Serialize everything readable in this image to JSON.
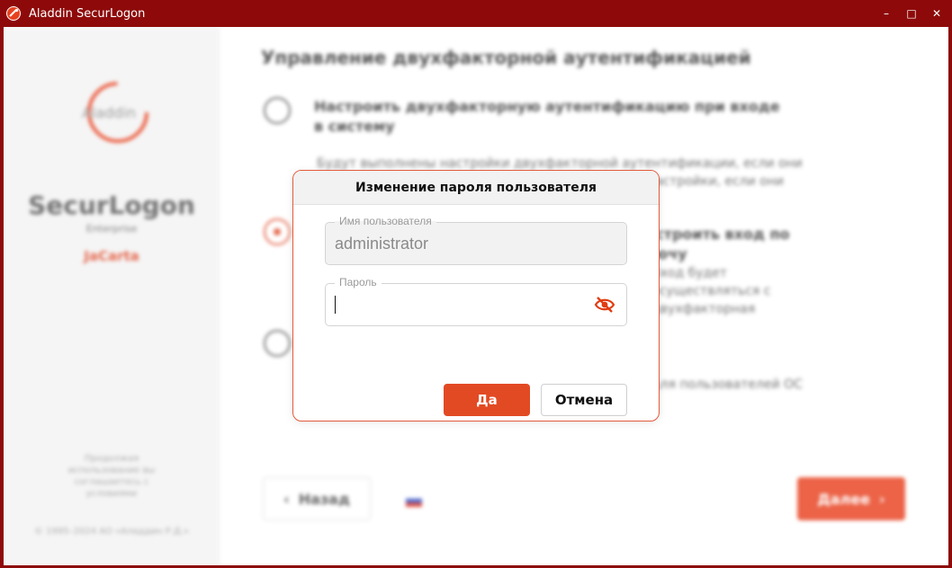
{
  "window": {
    "title": "Aladdin SecurLogon",
    "controls": {
      "minimize": "–",
      "maximize": "□",
      "close": "✕"
    }
  },
  "sidebar": {
    "logo_text": "Aladdin",
    "product_name": "SecurLogon",
    "edition": "Enterprise",
    "variant": "JaCarta",
    "note": "Продолжая использование вы соглашаетесь с условиями",
    "copyright": "© 1995–2024 АО «Аладдин Р.Д.»"
  },
  "main": {
    "title": "Управление двухфакторной аутентификацией",
    "options": [
      {
        "title": "Настроить двухфакторную аутентификацию при входе в систему",
        "description": "Будут выполнены настройки двухфакторной аутентификации, если они до этого не были выполнены, а также изменены настройки, если они",
        "checked": false
      },
      {
        "title": "Настроить вход по ключу",
        "description": "Вход будет осуществляться с двухфакторная",
        "checked": true
      },
      {
        "title": "",
        "description": "для пользователей ОС",
        "checked": false
      }
    ],
    "back_label": "Назад",
    "next_label": "Далее"
  },
  "dialog": {
    "title": "Изменение пароля пользователя",
    "username_label": "Имя пользователя",
    "username_value": "administrator",
    "password_label": "Пароль",
    "password_value": "",
    "ok_label": "Да",
    "cancel_label": "Отмена"
  },
  "colors": {
    "accent": "#e24a24",
    "titlebar": "#8e0a0a",
    "dialog_border": "#e25a3c"
  }
}
